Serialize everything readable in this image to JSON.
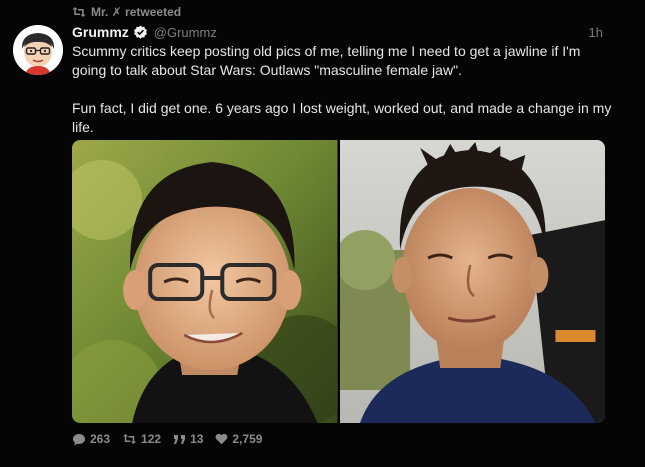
{
  "retweet": {
    "text": "Mr. ✗ retweeted"
  },
  "author": {
    "name": "Grummz",
    "handle": "@Grummz",
    "time": "1h"
  },
  "tweet": {
    "paragraph1": "Scummy critics keep posting old pics of me, telling me I need to get a jawline if I'm going to talk about Star Wars: Outlaws \"masculine female jaw\".",
    "paragraph2": "Fun fact, I did get one. 6 years ago I lost weight, worked out, and made a change in my life."
  },
  "actions": {
    "replies": "263",
    "retweets": "122",
    "quotes": "13",
    "likes": "2,759"
  },
  "icons": {
    "retweet": "retweet-icon",
    "verified": "verified-badge-icon",
    "reply": "reply-icon",
    "quote": "quote-icon",
    "like": "heart-icon"
  },
  "colors": {
    "background": "#050505",
    "text": "#e6e6e6",
    "muted": "#7d7d7d",
    "verified": "#ffffff"
  }
}
